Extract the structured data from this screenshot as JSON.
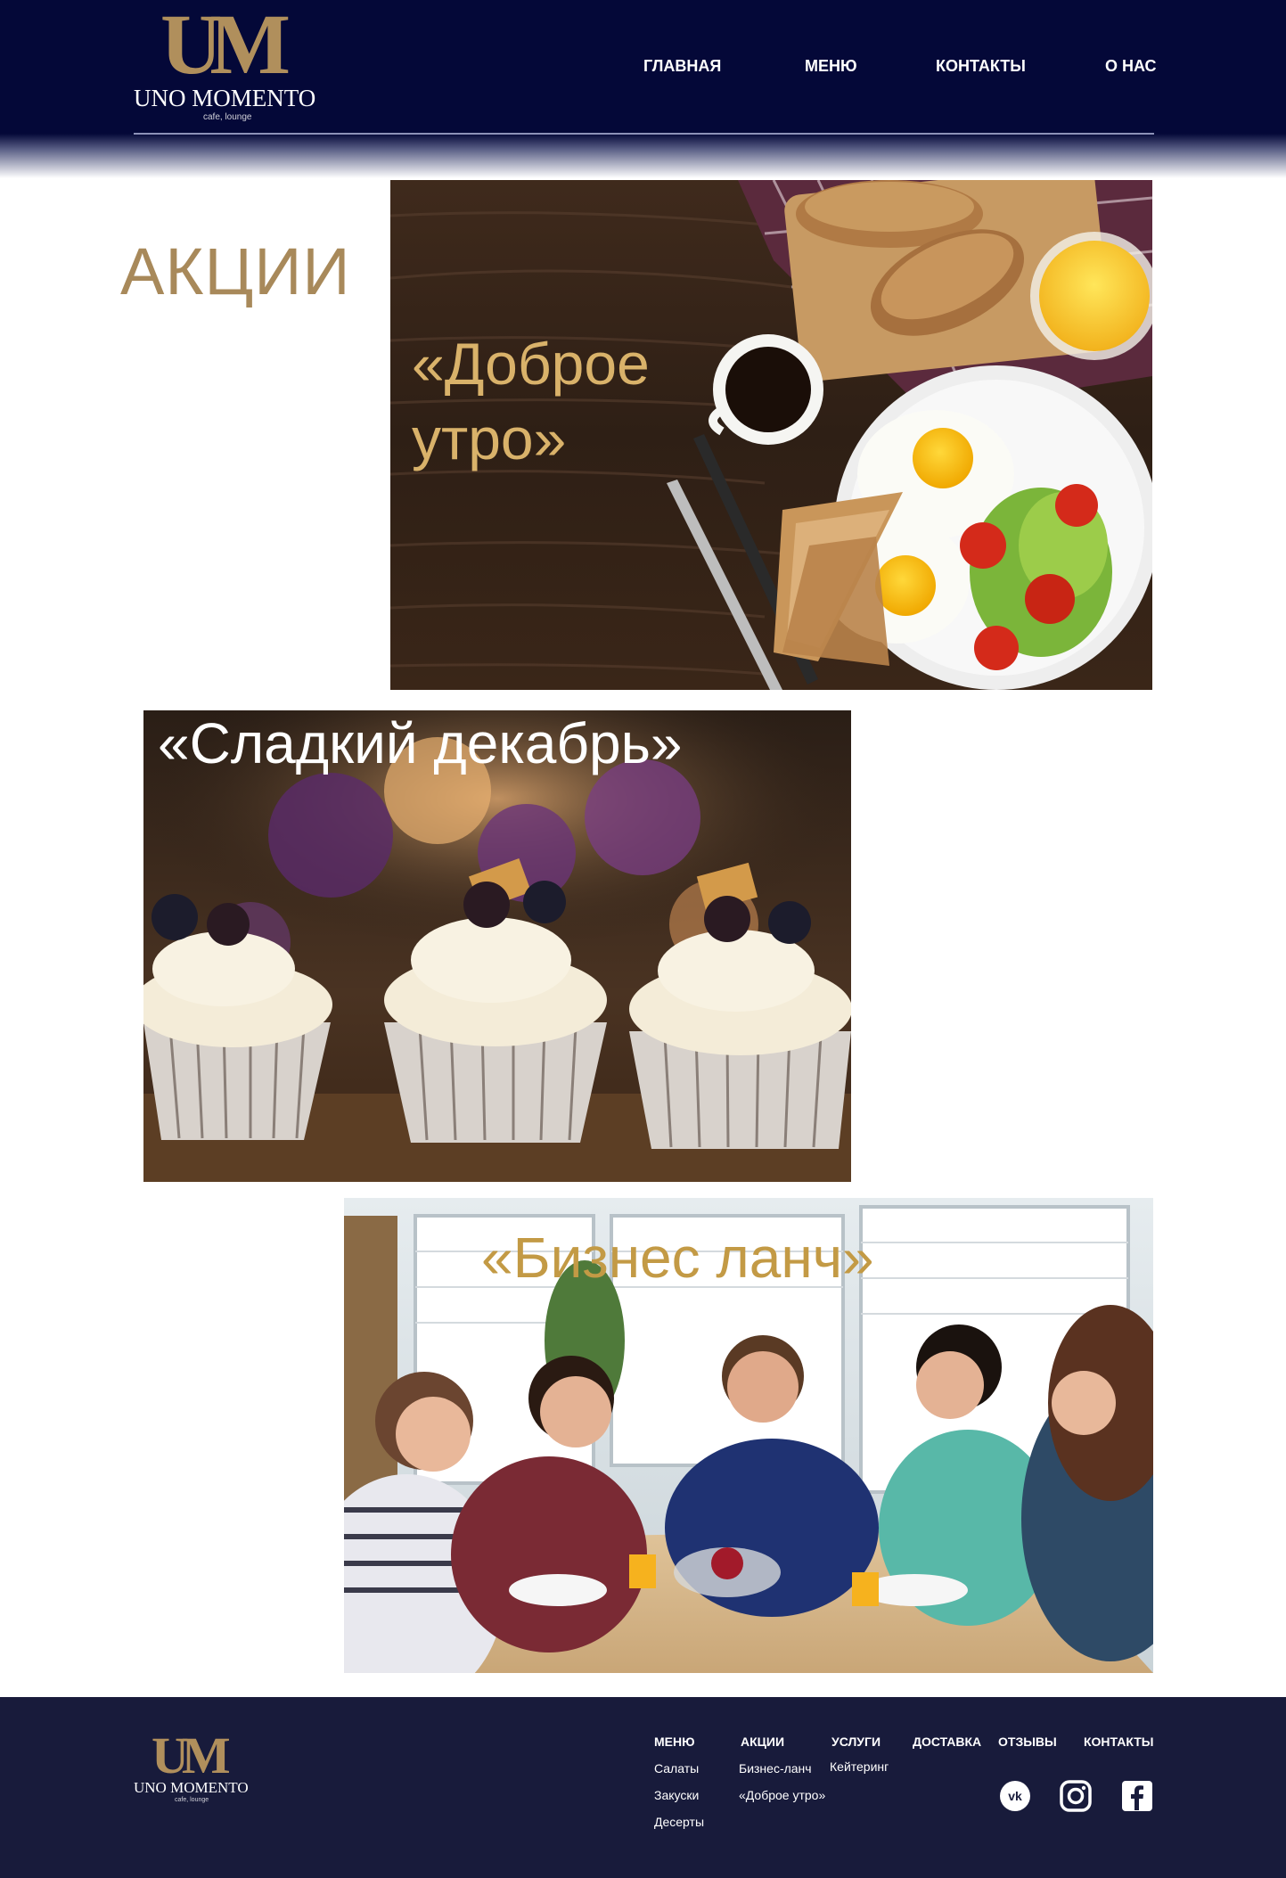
{
  "brand": {
    "mark": "UM",
    "name": "UNO MOMENTO",
    "tagline": "cafe, lounge"
  },
  "nav": {
    "items": [
      "ГЛАВНАЯ",
      "МЕНЮ",
      "КОНТАКТЫ",
      "О НАС"
    ]
  },
  "page": {
    "title": "АКЦИИ"
  },
  "promos": [
    {
      "title": "«Доброе утро»",
      "title_line1": "«Доброе",
      "title_line2": "утро»",
      "color": "#d9b26a"
    },
    {
      "title": "«Сладкий декабрь»",
      "color": "#ffffff"
    },
    {
      "title": "«Бизнес ланч»",
      "color": "#c39a45"
    }
  ],
  "footer": {
    "columns": [
      {
        "heading": "МЕНЮ",
        "links": [
          "Салаты",
          "Закуски",
          "Десерты"
        ]
      },
      {
        "heading": "АКЦИИ",
        "links": [
          "Бизнес-ланч",
          "«Доброе утро»"
        ]
      },
      {
        "heading": "УСЛУГИ",
        "links": [
          "Кейтеринг"
        ]
      },
      {
        "heading": "ДОСТАВКА",
        "links": []
      },
      {
        "heading": "ОТЗЫВЫ",
        "links": []
      },
      {
        "heading": "КОНТАКТЫ",
        "links": []
      }
    ],
    "social": [
      {
        "icon": "vk-icon",
        "label": "VK"
      },
      {
        "icon": "instagram-icon",
        "label": "Instagram"
      },
      {
        "icon": "facebook-icon",
        "label": "Facebook"
      }
    ]
  },
  "colors": {
    "header_bg": "#040838",
    "footer_bg": "#181b3b",
    "gold": "#a8895a"
  }
}
